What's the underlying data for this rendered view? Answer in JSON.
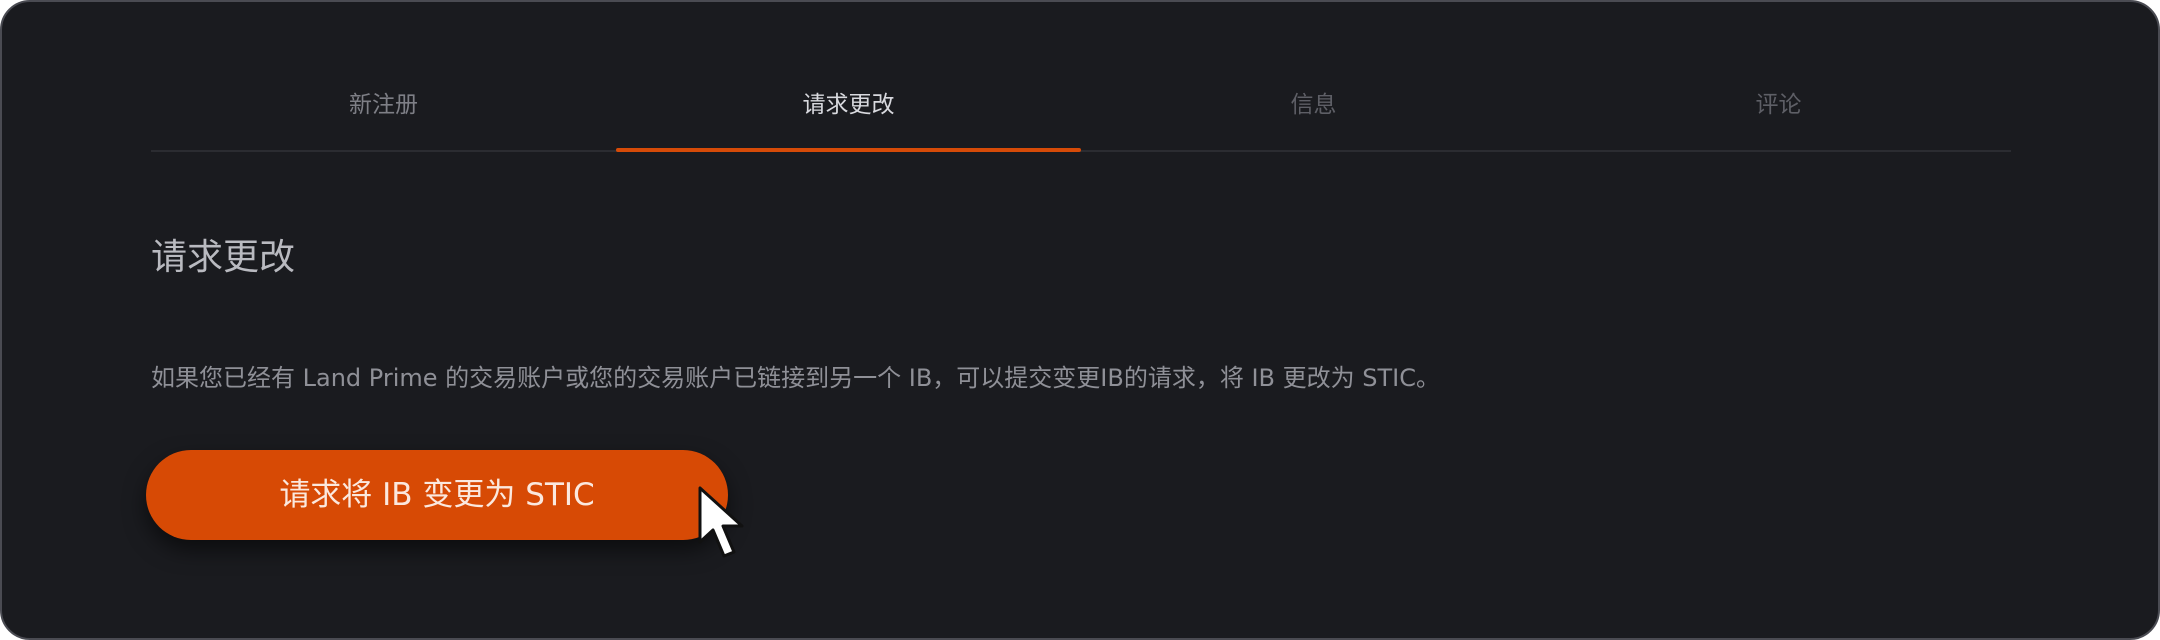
{
  "tabs": [
    {
      "label": "新注册"
    },
    {
      "label": "请求更改"
    },
    {
      "label": "信息"
    },
    {
      "label": "评论"
    }
  ],
  "active_tab": "请求更改",
  "section": {
    "title": "请求更改",
    "description": "如果您已经有 Land Prime 的交易账户或您的交易账户已链接到另一个 IB，可以提交变更IB的请求，将 IB 更改为 STIC。"
  },
  "cta_button": {
    "label": "请求将 IB 变更为 STIC"
  },
  "colors": {
    "background": "#1a1b1f",
    "accent": "#d74a05",
    "active_tab_text": "#d8d9de",
    "inactive_tab_text": "#7e7f86"
  },
  "icons": {
    "cursor": "mouse-pointer-icon"
  }
}
